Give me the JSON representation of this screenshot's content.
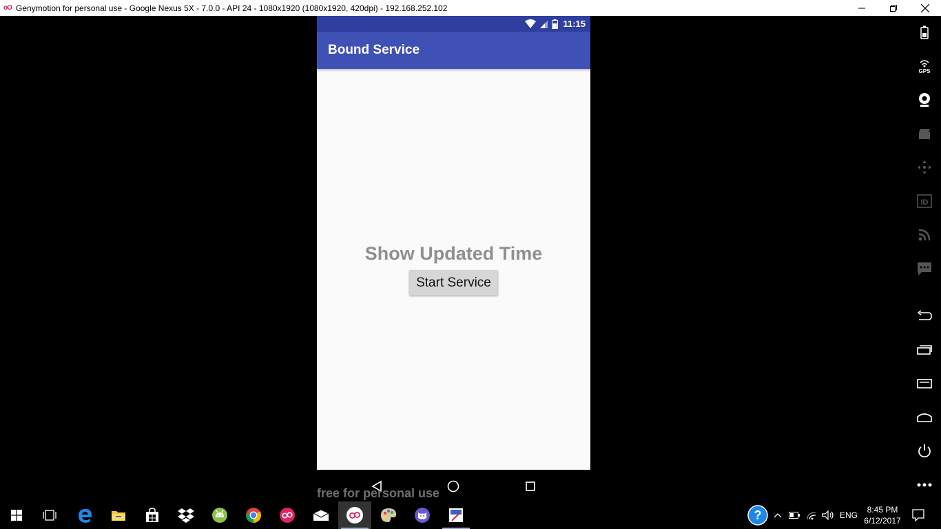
{
  "window": {
    "title": "Genymotion for personal use - Google Nexus 5X - 7.0.0 - API 24 - 1080x1920 (1080x1920, 420dpi) - 192.168.252.102",
    "logo_text": "oO"
  },
  "status_bar": {
    "time": "11:15"
  },
  "app_bar": {
    "title": "Bound Service"
  },
  "content": {
    "time_label": "Show Updated Time",
    "start_button": "Start Service"
  },
  "watermark": "free for personal use",
  "side_toolbar": {
    "items": [
      "battery-icon",
      "gps-icon",
      "webcam-icon",
      "capture-icon",
      "remote-control-icon",
      "device-id-icon",
      "network-icon",
      "sms-icon",
      "back-icon",
      "recent-apps-icon",
      "menu-icon",
      "home-icon",
      "power-icon",
      "more-icon"
    ],
    "gps_label": "GPS",
    "id_label": "ID"
  },
  "taskbar": {
    "genymotion_label": "oO",
    "tray_lang": "ENG",
    "clock_time": "8:45 PM",
    "clock_date": "6/12/2017"
  }
}
